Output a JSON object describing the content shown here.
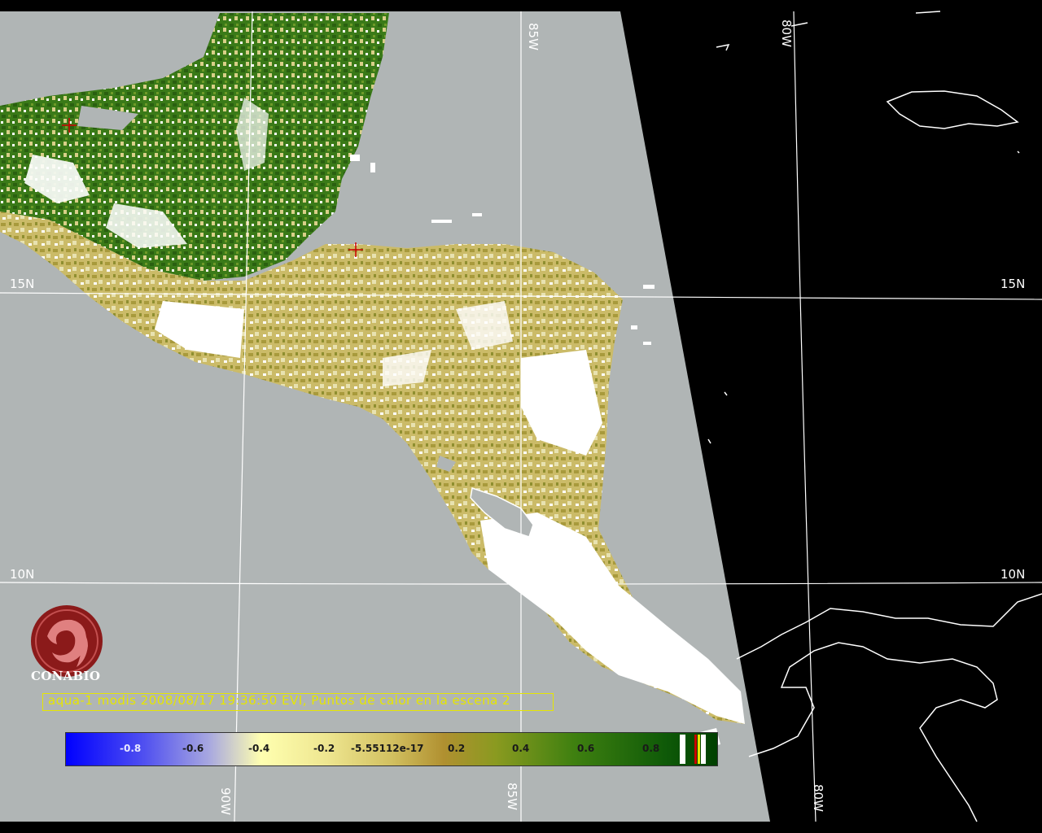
{
  "map": {
    "lat_labels": {
      "n15_left": "15N",
      "n15_right": "15N",
      "n10_left": "10N",
      "n10_right": "10N"
    },
    "lon_labels": {
      "w85_top": "85W",
      "w80_top": "80W",
      "w90_bottom": "90W",
      "w85_bottom": "85W",
      "w80_bottom": "80W"
    }
  },
  "logo": {
    "text": "CONABIO",
    "color": "#8b1a1a"
  },
  "caption": "aqua-1 modis 2008/08/17 19:36:50 EVI, Puntos de calor en la escena 2",
  "legend": {
    "ticks": [
      "-0.8",
      "-0.6",
      "-0.4",
      "-0.2",
      "-5.55112e-17",
      "0.2",
      "0.4",
      "0.6",
      "0.8"
    ]
  },
  "colors": {
    "swath_gray": "#b0b5b5",
    "vegetation_dark": "#2f6f10",
    "vegetation_light": "#c8b85a",
    "cloud": "#ffffff",
    "caption_yellow": "#e6e600",
    "hotspot_red": "#cc0000"
  }
}
